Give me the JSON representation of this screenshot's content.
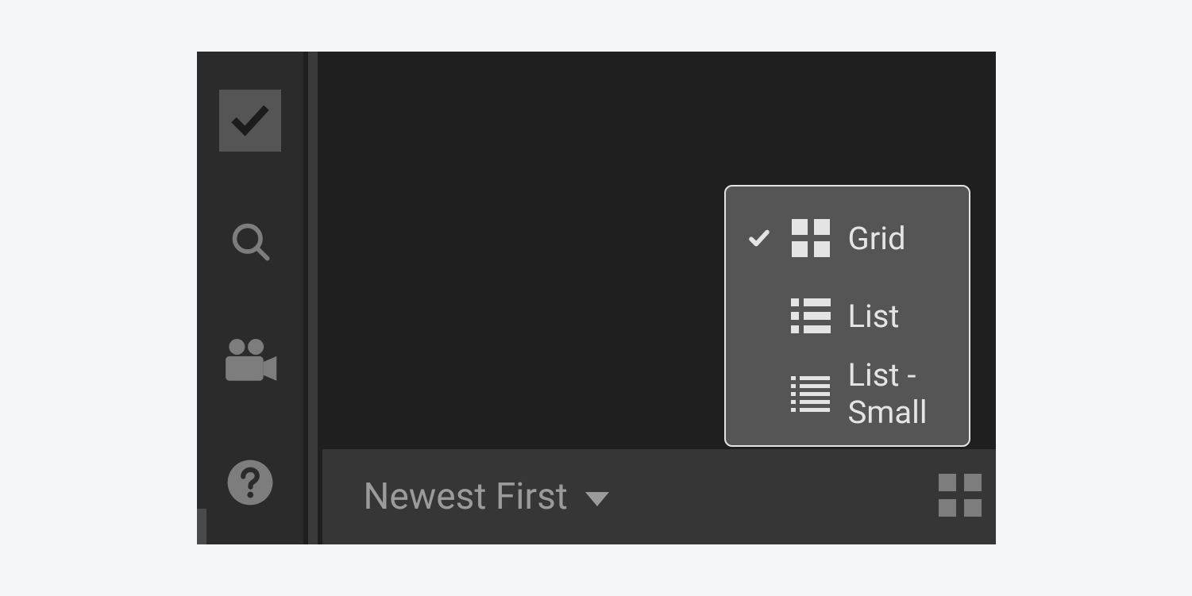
{
  "toolbar": {
    "items": [
      {
        "name": "check-button",
        "icon": "check-icon",
        "active": true
      },
      {
        "name": "search-button",
        "icon": "search-icon",
        "active": false
      },
      {
        "name": "video-button",
        "icon": "video-camera-icon",
        "active": false
      },
      {
        "name": "help-button",
        "icon": "help-icon",
        "active": false
      }
    ]
  },
  "bottom_bar": {
    "sort_label": "Newest First",
    "view_toggle_icon": "grid-icon"
  },
  "view_menu": {
    "options": [
      {
        "label": "Grid",
        "icon": "grid-icon",
        "selected": true
      },
      {
        "label": "List",
        "icon": "list-icon",
        "selected": false
      },
      {
        "label": "List - Small",
        "icon": "list-small-icon",
        "selected": false
      }
    ]
  }
}
